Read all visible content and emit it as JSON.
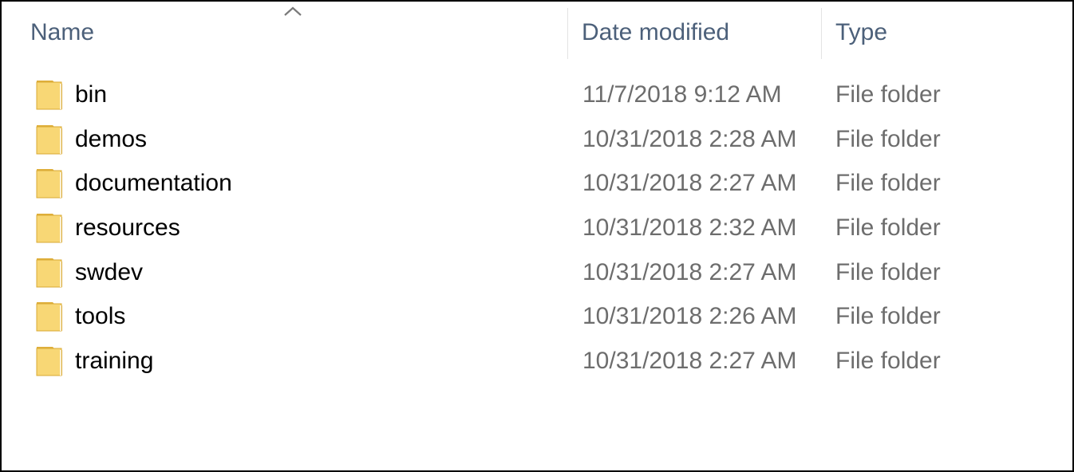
{
  "columns": {
    "name": "Name",
    "date_modified": "Date modified",
    "type": "Type",
    "sort_indicator": "chevron-up-icon"
  },
  "files": [
    {
      "name": "bin",
      "date": "11/7/2018 9:12 AM",
      "type": "File folder",
      "icon": "folder-icon"
    },
    {
      "name": "demos",
      "date": "10/31/2018 2:28 AM",
      "type": "File folder",
      "icon": "folder-icon"
    },
    {
      "name": "documentation",
      "date": "10/31/2018 2:27 AM",
      "type": "File folder",
      "icon": "folder-icon"
    },
    {
      "name": "resources",
      "date": "10/31/2018 2:32 AM",
      "type": "File folder",
      "icon": "folder-icon"
    },
    {
      "name": "swdev",
      "date": "10/31/2018 2:27 AM",
      "type": "File folder",
      "icon": "folder-icon"
    },
    {
      "name": "tools",
      "date": "10/31/2018 2:26 AM",
      "type": "File folder",
      "icon": "folder-icon"
    },
    {
      "name": "training",
      "date": "10/31/2018 2:27 AM",
      "type": "File folder",
      "icon": "folder-icon"
    }
  ],
  "colors": {
    "header_text": "#4c607a",
    "secondary_text": "#6d6d6d",
    "folder_fill": "#f8d775",
    "folder_edge": "#e0b03c"
  }
}
